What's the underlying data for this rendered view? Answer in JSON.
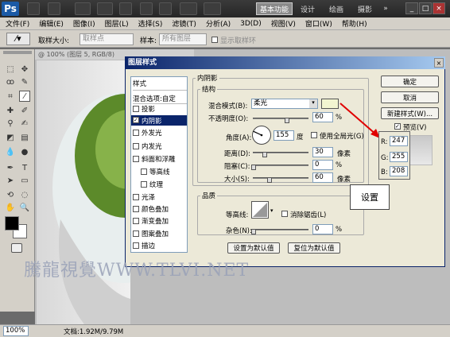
{
  "titlebar": {
    "logo": "Ps",
    "workspaces": [
      "基本功能",
      "设计",
      "绘画",
      "摄影"
    ],
    "more": "»"
  },
  "menubar": [
    "文件(F)",
    "编辑(E)",
    "图像(I)",
    "图层(L)",
    "选择(S)",
    "滤镜(T)",
    "分析(A)",
    "3D(D)",
    "视图(V)",
    "窗口(W)",
    "帮助(H)"
  ],
  "options": {
    "sample_size_label": "取样大小:",
    "sample_size_value": "取样点",
    "sample_label": "样本:",
    "sample_value": "所有图层",
    "show_ring": "显示取样环"
  },
  "document": {
    "tab": "@ 100% (图层 5, RGB/8)"
  },
  "status": {
    "zoom": "100%",
    "doc": "文档:1.92M/9.79M"
  },
  "dialog": {
    "title": "图层样式",
    "close": "×",
    "styles_header": "样式",
    "blend_options": "混合选项:自定",
    "styles": [
      "投影",
      "内阴影",
      "外发光",
      "内发光",
      "斜面和浮雕",
      "等高线",
      "纹理",
      "光泽",
      "颜色叠加",
      "渐变叠加",
      "图案叠加",
      "描边"
    ],
    "inner_shadow": {
      "section": "内阴影",
      "structure": "结构",
      "blend_mode_label": "混合模式(B):",
      "blend_mode": "柔光",
      "opacity_label": "不透明度(O):",
      "opacity": "60",
      "angle_label": "角度(A):",
      "angle": "155",
      "degree": "度",
      "global_light": "使用全局光(G)",
      "distance_label": "距离(D):",
      "distance": "30",
      "choke_label": "阻塞(C):",
      "choke": "0",
      "size_label": "大小(S):",
      "size": "60",
      "unit_px": "像素",
      "unit_pct": "%"
    },
    "quality": {
      "section": "品质",
      "contour_label": "等高线:",
      "anti_alias": "消除锯齿(L)",
      "noise_label": "杂色(N):",
      "noise": "0"
    },
    "buttons": {
      "make_default": "设置为默认值",
      "reset_default": "复位为默认值",
      "ok": "确定",
      "cancel": "取消",
      "new_style": "新建样式(W)...",
      "preview": "预览(V)"
    },
    "shadow_color": "#f2f5d0"
  },
  "rgb": {
    "r_label": "R:",
    "r": "247",
    "g_label": "G:",
    "g": "255",
    "b_label": "B:",
    "b": "208"
  },
  "callout": "设置",
  "watermark": "騰龍視覺WWW.TLVI.NET"
}
